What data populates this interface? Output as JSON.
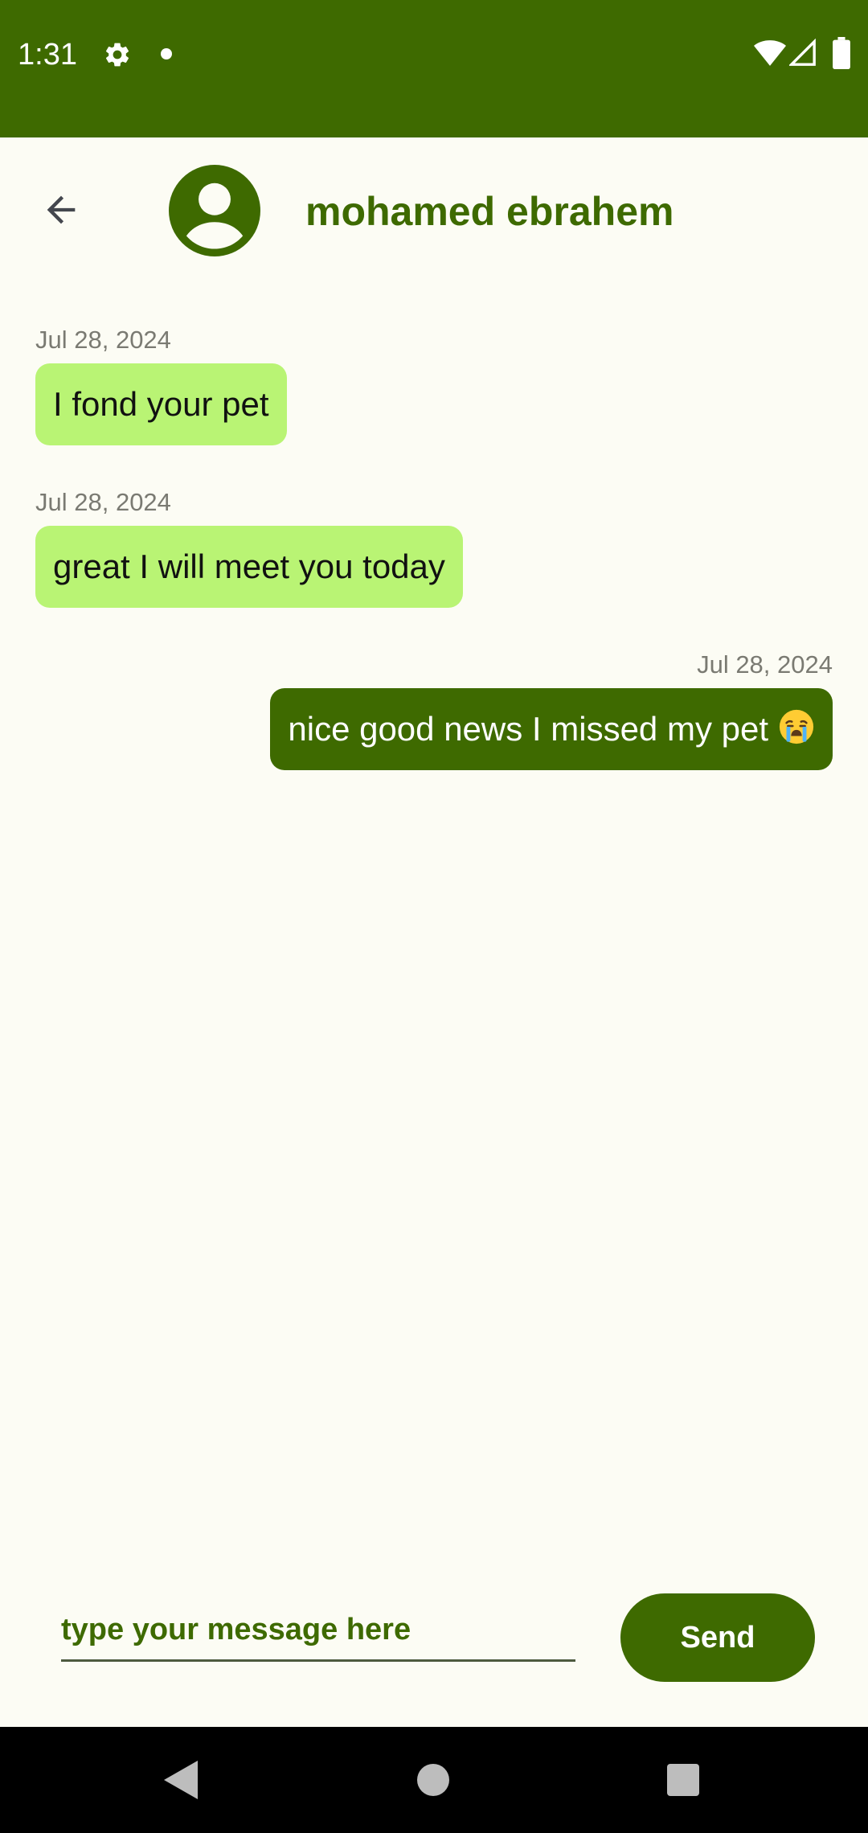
{
  "status_bar": {
    "time": "1:31",
    "icons": [
      "gear-icon",
      "notification-dot-icon",
      "wifi-icon",
      "signal-icon",
      "battery-icon"
    ],
    "background": "#3e6a00"
  },
  "header": {
    "back_icon": "arrow-left-icon",
    "avatar_icon": "account-circle-icon",
    "contact_name": "mohamed ebrahem"
  },
  "messages": [
    {
      "date": "Jul 28, 2024",
      "text": "I fond your pet",
      "direction": "incoming"
    },
    {
      "date": "Jul 28, 2024",
      "text": "great I will meet you today",
      "direction": "incoming"
    },
    {
      "date": "Jul 28, 2024",
      "text": "nice good news I missed my pet",
      "emoji": "crying-face-emoji",
      "direction": "outgoing"
    }
  ],
  "composer": {
    "placeholder": "type your message here",
    "value": "",
    "send_label": "Send"
  },
  "nav_bar": {
    "icons": [
      "nav-back-icon",
      "nav-home-icon",
      "nav-recents-icon"
    ]
  },
  "colors": {
    "primary": "#3e6a00",
    "incoming_bubble": "#b9f474",
    "background": "#fcfcf4",
    "date_text": "#7a7a72"
  }
}
